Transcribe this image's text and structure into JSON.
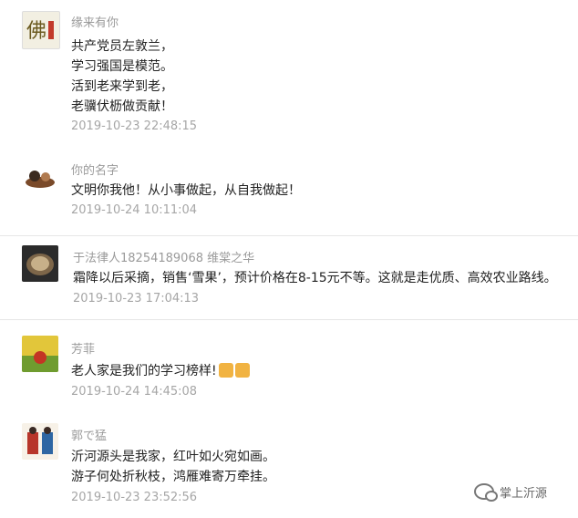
{
  "comments": [
    {
      "name": "缘来有你",
      "lines": [
        "共产党员左敦兰，",
        "学习强国是模范。",
        "活到老来学到老，",
        "老骥伏枥做贡献！"
      ],
      "time": "2019-10-23 22:48:15"
    },
    {
      "name": "你的名字",
      "lines": [
        "文明你我他！从小事做起，从自我做起！"
      ],
      "time": "2019-10-24 10:11:04"
    },
    {
      "name": "于法律人18254189068 维棠之华",
      "lines": [
        "霜降以后采摘，销售‘雪果’，预计价格在8-15元不等。这就是走优质、高效农业路线。"
      ],
      "time": "2019-10-23 17:04:13"
    },
    {
      "name": "芳菲",
      "lines": [
        "老人家是我们的学习榜样!"
      ],
      "time": "2019-10-24 14:45:08"
    },
    {
      "name": "郭で猛",
      "lines": [
        "沂河源头是我家，红叶如火宛如画。",
        "游子何处折秋枝，鸿雁难寄万牵挂。"
      ],
      "time": "2019-10-23 23:52:56"
    }
  ],
  "watermark": {
    "text": "掌上沂源",
    "icon": "wechat-icon"
  }
}
